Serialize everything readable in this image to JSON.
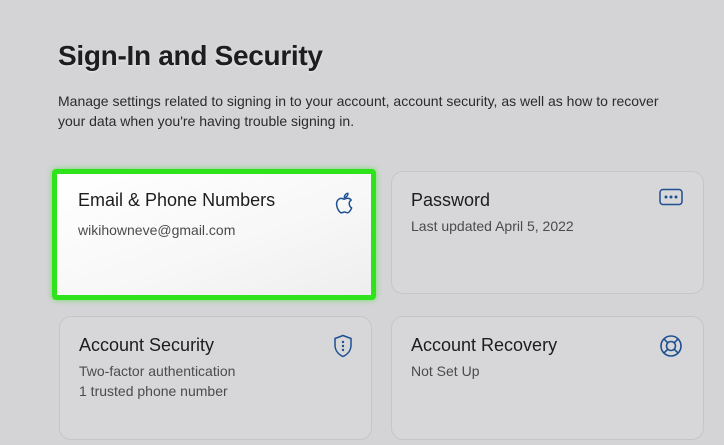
{
  "page": {
    "title": "Sign-In and Security",
    "description": "Manage settings related to signing in to your account, account security, as well as how to recover your data when you're having trouble signing in."
  },
  "cards": {
    "email": {
      "title": "Email & Phone Numbers",
      "subtitle": "wikihowneve@gmail.com",
      "icon": "apple-icon",
      "selected": true
    },
    "password": {
      "title": "Password",
      "subtitle": "Last updated April 5, 2022",
      "icon": "password-dots-icon"
    },
    "security": {
      "title": "Account Security",
      "subtitle_line1": "Two-factor authentication",
      "subtitle_line2": "1 trusted phone number",
      "icon": "shield-icon"
    },
    "recovery": {
      "title": "Account Recovery",
      "subtitle": "Not Set Up",
      "icon": "lifebuoy-icon"
    }
  },
  "colors": {
    "accent_blue": "#1d4f91",
    "highlight_green": "#2ee31c",
    "background": "#d4d4d6"
  }
}
